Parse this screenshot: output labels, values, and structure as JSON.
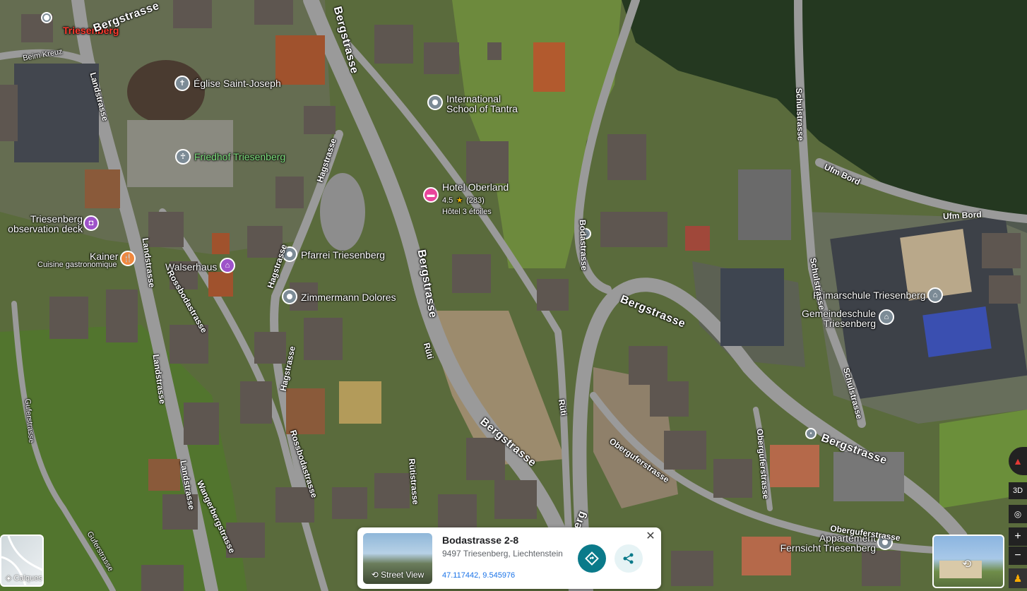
{
  "place_labels": {
    "triesenberg": "Triesenberg",
    "eglise": "Église Saint-Joseph",
    "friedhof": "Friedhof Triesenberg",
    "intl_school": "International School of Tantra",
    "hotel_name": "Hotel Oberland",
    "hotel_rating": "4.5",
    "hotel_reviews": "(283)",
    "hotel_type": "Hôtel 3 étoiles",
    "observation": "Triesenberg observation deck",
    "kainer": "Kainer",
    "kainer_sub": "Cuisine gastronomique",
    "walserhaus": "Walserhaus",
    "pfarrei": "Pfarrei Triesenberg",
    "zimmermann": "Zimmermann Dolores",
    "primarschule": "Primarschule Triesenberg",
    "gemeindeschule": "Gemeindeschule Triesenberg",
    "appartement": "Appartement Fernsicht Triesenberg"
  },
  "street_labels": {
    "beim_kreuz": "Beim Kreuz",
    "bergstrasse": "Bergstrasse",
    "landstrasse": "Landstrasse",
    "hagstrasse": "Hagstrasse",
    "rossbodastrasse": "Rossbodastrasse",
    "wangerbergstrasse": "Wangerbergstrasse",
    "gufer": "Guferstrasse",
    "bodastrasse": "Bodastrasse",
    "schulstrasse": "Schulstrasse",
    "ufm_bord": "Ufm Bord",
    "obergufer": "Oberguferstrasse",
    "ruti": "Rüti",
    "rutistrasse": "Rütistrasse",
    "berg": "Berg"
  },
  "info_card": {
    "title": "Bodastrasse 2-8",
    "address": "9497 Triesenberg, Liechtenstein",
    "coords": "47.117442, 9.545976",
    "street_view_label": "Street View",
    "close_icon": "close-icon",
    "directions_icon": "directions-icon",
    "share_icon": "share-icon"
  },
  "controls": {
    "layers_label": "Calques",
    "btn_3d": "3D",
    "zoom_in": "+",
    "zoom_out": "−"
  },
  "colors": {
    "hotel_pin": "#e8449a",
    "grey_pin": "#7c8b96",
    "purple_pin": "#9e53c9",
    "orange_pin": "#f0883e",
    "directions_btn": "#0b7a8a",
    "coords_link": "#1a73e8"
  }
}
